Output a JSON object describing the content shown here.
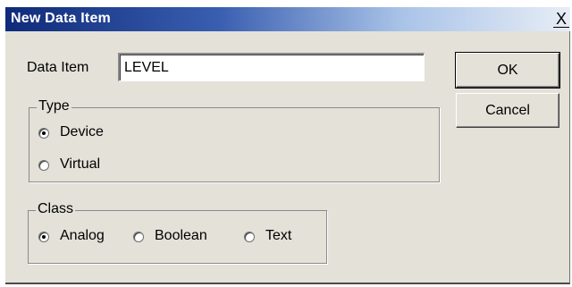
{
  "dialog": {
    "title": "New Data Item",
    "close_label": "X"
  },
  "data_item": {
    "label": "Data Item",
    "value": "LEVEL"
  },
  "buttons": {
    "ok": "OK",
    "cancel": "Cancel"
  },
  "type_group": {
    "legend": "Type",
    "options": [
      {
        "label": "Device",
        "checked": true
      },
      {
        "label": "Virtual",
        "checked": false
      }
    ]
  },
  "class_group": {
    "legend": "Class",
    "options": [
      {
        "label": "Analog",
        "checked": true
      },
      {
        "label": "Boolean",
        "checked": false
      },
      {
        "label": "Text",
        "checked": false
      }
    ]
  },
  "colors": {
    "titlebar_start": "#0f2a7a",
    "dialog_face": "#e3e1d8"
  }
}
